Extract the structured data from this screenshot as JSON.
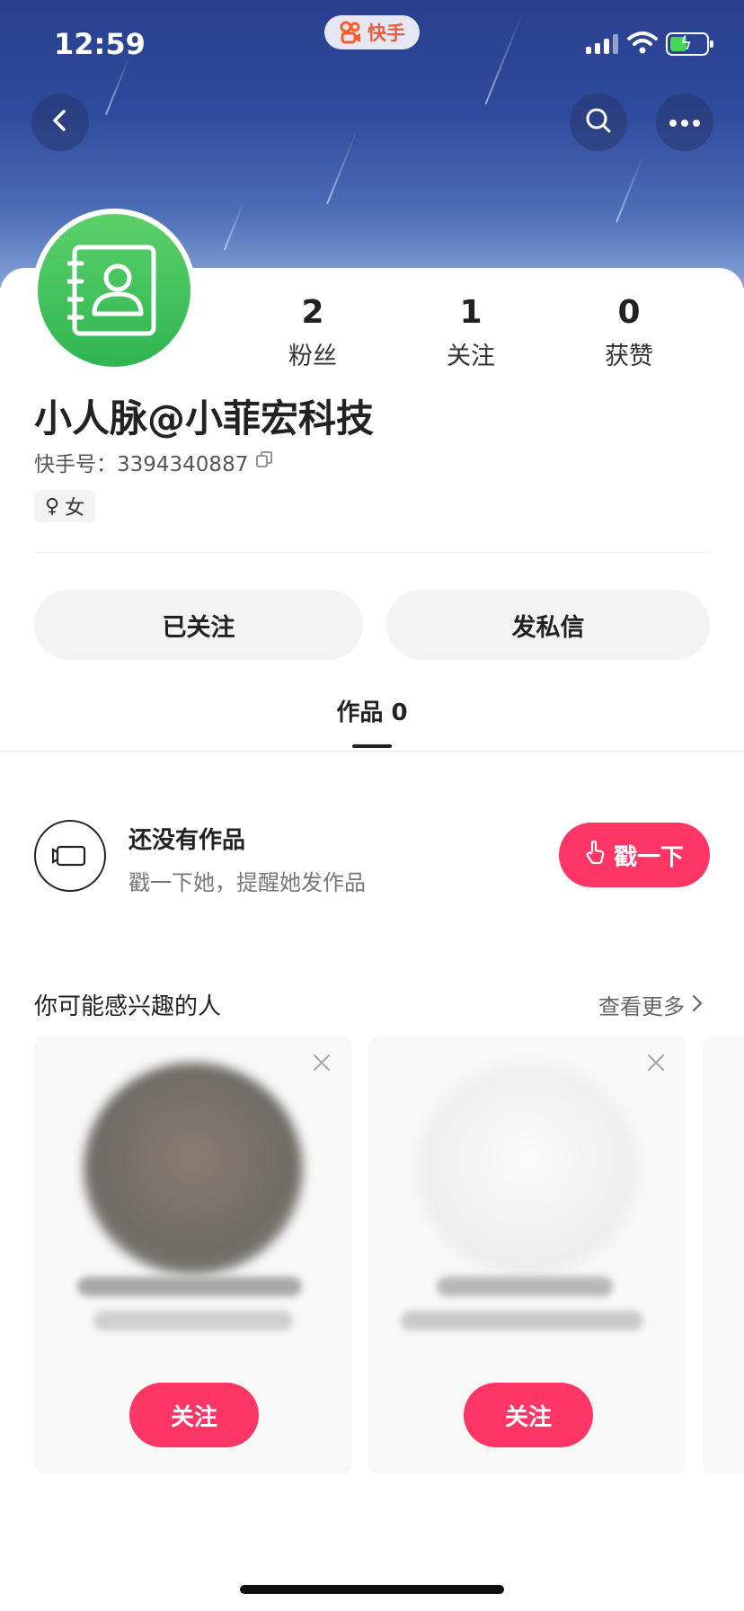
{
  "status_bar": {
    "time": "12:59",
    "app_name": "快手"
  },
  "header": {
    "back_icon": "back-arrow-icon",
    "search_icon": "search-icon",
    "more_icon": "more-dots-icon"
  },
  "profile": {
    "avatar_icon": "contacts-book-icon",
    "avatar_color": "#3fc25b",
    "stats": [
      {
        "num": "2",
        "label": "粉丝"
      },
      {
        "num": "1",
        "label": "关注"
      },
      {
        "num": "0",
        "label": "获赞"
      }
    ],
    "nickname": "小人脉@小菲宏科技",
    "kuaishou_id_label": "快手号：",
    "kuaishou_id": "3394340887",
    "gender_symbol": "♀",
    "gender": "女"
  },
  "actions": {
    "followed_label": "已关注",
    "message_label": "发私信"
  },
  "tabs": {
    "works_label": "作品",
    "works_count": "0"
  },
  "empty_state": {
    "title": "还没有作品",
    "subtitle": "戳一下她，提醒她发作品",
    "poke_label": "戳一下"
  },
  "recommend": {
    "title": "你可能感兴趣的人",
    "see_more": "查看更多",
    "cards": [
      {
        "follow_label": "关注"
      },
      {
        "follow_label": "关注"
      }
    ]
  },
  "colors": {
    "accent": "#fe3666",
    "header_blue": "#2f4b9d"
  }
}
